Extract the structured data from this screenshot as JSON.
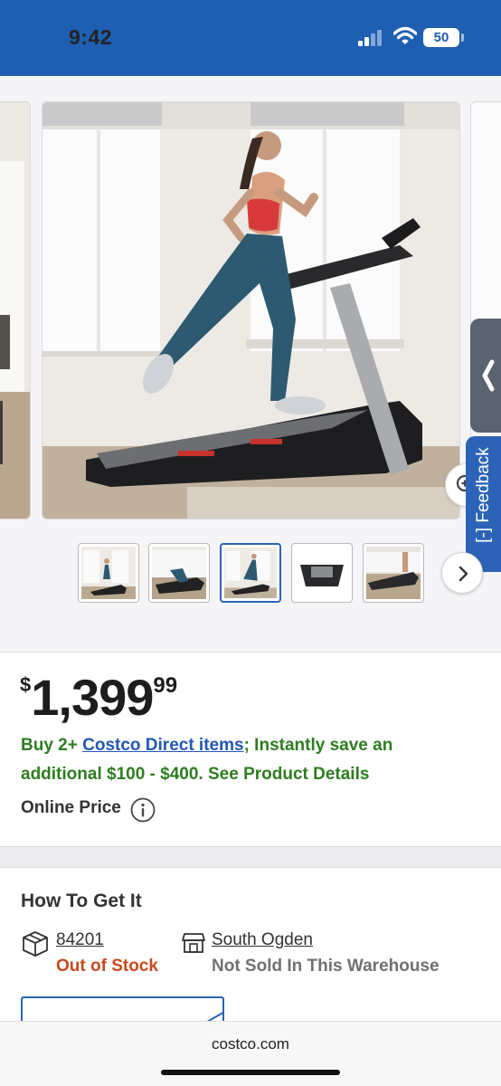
{
  "status_bar": {
    "time": "9:42",
    "battery": "50"
  },
  "gallery": {
    "thumbnail_count": 5,
    "selected_thumbnail": 3,
    "feedback_label": "[-] Feedback"
  },
  "product": {
    "price": {
      "currency": "$",
      "whole": "1,399",
      "cents": "99"
    },
    "promo": {
      "prefix": "Buy 2+ ",
      "link": "Costco Direct items",
      "suffix": "; Instantly save an additional $100 - $400. See Product Details"
    },
    "online_price_label": "Online Price"
  },
  "how_to_get_it": {
    "title": "How To Get It",
    "zip": "84201",
    "stock_status": "Out of Stock",
    "warehouse": "South Ogden",
    "warehouse_status": "Not Sold In This Warehouse"
  },
  "browser": {
    "url": "costco.com"
  },
  "colors": {
    "header_blue": "#1f5fb2",
    "promo_green": "#2e7d20",
    "link_blue": "#2358b5",
    "out_of_stock": "#c9491d"
  }
}
